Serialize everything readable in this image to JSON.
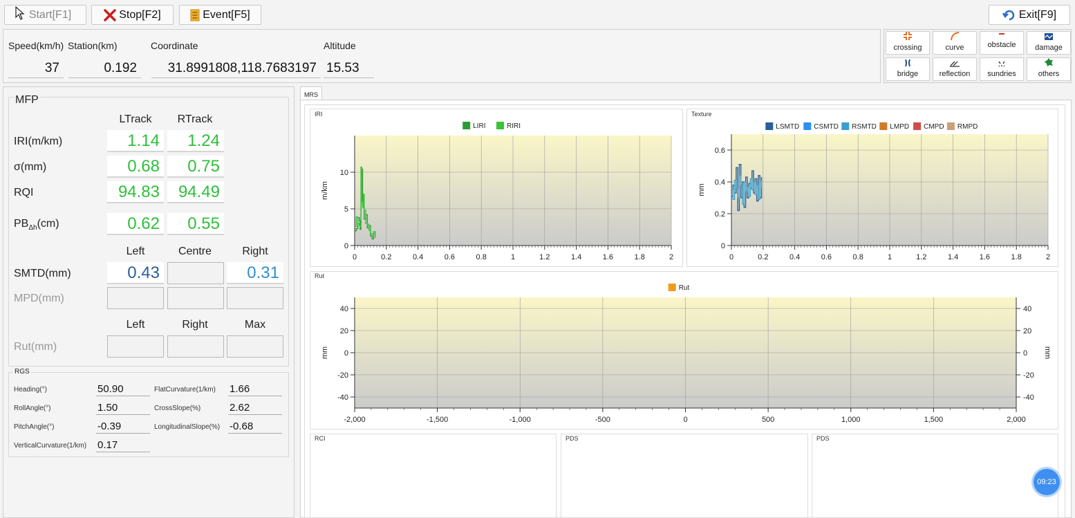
{
  "toolbar": {
    "start_label": "Start[F1]",
    "stop_label": "Stop[F2]",
    "event_label": "Event[F5]",
    "exit_label": "Exit[F9]"
  },
  "info": {
    "speed_label": "Speed(km/h)",
    "station_label": "Station(km)",
    "coordinate_label": "Coordinate",
    "altitude_label": "Altitude",
    "speed": "37",
    "station": "0.192",
    "coordinate": "31.8991808,118.7683197",
    "altitude": "15.53"
  },
  "events": [
    {
      "label": "crossing",
      "icon": "crossing-icon"
    },
    {
      "label": "curve",
      "icon": "curve-icon"
    },
    {
      "label": "obstacle",
      "icon": "obstacle-icon"
    },
    {
      "label": "damage",
      "icon": "damage-icon"
    },
    {
      "label": "bridge",
      "icon": "bridge-icon"
    },
    {
      "label": "reflection",
      "icon": "reflection-icon"
    },
    {
      "label": "sundries",
      "icon": "sundries-icon"
    },
    {
      "label": "others",
      "icon": "others-icon"
    }
  ],
  "mfp": {
    "title": "MFP",
    "ltrack_header": "LTrack",
    "rtrack_header": "RTrack",
    "iri_label": "IRI(m/km)",
    "sigma_label": "σ(mm)",
    "rqi_label": "RQI",
    "pb_label": "PB",
    "pb_sub": "Δh",
    "pb_unit": "(cm)",
    "iri_l": "1.14",
    "iri_r": "1.24",
    "sigma_l": "0.68",
    "sigma_r": "0.75",
    "rqi_l": "94.83",
    "rqi_r": "94.49",
    "pb_l": "0.62",
    "pb_r": "0.55",
    "left_header": "Left",
    "centre_header": "Centre",
    "right_header": "Right",
    "smtd_label": "SMTD(mm)",
    "mpd_label": "MPD(mm)",
    "smtd_left": "0.43",
    "smtd_centre": "",
    "smtd_right": "0.31",
    "rut_left_header": "Left",
    "rut_right_header": "Right",
    "rut_max_header": "Max",
    "rut_label": "Rut(mm)"
  },
  "rgs": {
    "title": "RGS",
    "heading_label": "Heading(°)",
    "heading": "50.90",
    "roll_label": "RollAngle(°)",
    "roll": "1.50",
    "pitch_label": "PitchAngle(°)",
    "pitch": "-0.39",
    "vcurv_label": "VerticalCurvature(1/km)",
    "vcurv": "0.17",
    "flatcurv_label": "FlatCurvature(1/km)",
    "flatcurv": "1.66",
    "cross_label": "CrossSlope(%)",
    "cross": "2.62",
    "long_label": "LongitudinalSlope(%)",
    "long": "-0.68"
  },
  "tab_label": "MRS",
  "clock": "09:23",
  "colors": {
    "liri": "#2e9a35",
    "riri": "#39c43a",
    "lsmtd": "#2a5f9a",
    "csmtd": "#2d8ff0",
    "rsmtd": "#3aa0d0",
    "lmpd": "#d07a2a",
    "cmpd": "#d24b4b",
    "rmpd": "#c8a07a",
    "rut": "#f39a1c",
    "plot_top": "#faf6c8",
    "plot_bottom": "#cfcfcf"
  },
  "chart_data": [
    {
      "panel_title": "IRI",
      "type": "line",
      "ylabel": "m/km",
      "xlim": [
        0,
        2
      ],
      "ylim": [
        0,
        15
      ],
      "x_ticks": [
        "0",
        "0.2",
        "0.4",
        "0.6",
        "0.8",
        "1",
        "1.2",
        "1.4",
        "1.6",
        "1.8",
        "2"
      ],
      "y_ticks": [
        "0",
        "5",
        "10"
      ],
      "legend": [
        "LIRI",
        "RIRI"
      ],
      "series": [
        {
          "name": "LIRI",
          "color": "#2e9a35",
          "x": [
            0.0,
            0.01,
            0.02,
            0.03,
            0.035,
            0.04,
            0.045,
            0.05,
            0.055,
            0.06,
            0.07,
            0.08,
            0.09,
            0.1,
            0.11,
            0.12,
            0.13
          ],
          "y": [
            2.0,
            2.3,
            3.8,
            3.4,
            2.2,
            10.5,
            10.4,
            5.5,
            6.8,
            3.6,
            4.2,
            2.4,
            2.7,
            1.3,
            0.9,
            1.7,
            1.1
          ]
        },
        {
          "name": "RIRI",
          "color": "#39c43a",
          "x": [
            0.0,
            0.01,
            0.02,
            0.03,
            0.035,
            0.04,
            0.045,
            0.05,
            0.055,
            0.06,
            0.07,
            0.08,
            0.09,
            0.1,
            0.11,
            0.12,
            0.13
          ],
          "y": [
            2.6,
            3.9,
            3.0,
            2.7,
            2.5,
            10.7,
            6.0,
            5.2,
            7.0,
            4.8,
            3.0,
            2.9,
            2.1,
            1.6,
            1.5,
            1.9,
            1.2
          ]
        }
      ]
    },
    {
      "panel_title": "Texture",
      "type": "line",
      "ylabel": "mm",
      "xlim": [
        0,
        2
      ],
      "ylim": [
        0,
        0.7
      ],
      "x_ticks": [
        "0",
        "0.2",
        "0.4",
        "0.6",
        "0.8",
        "1",
        "1.2",
        "1.4",
        "1.6",
        "1.8",
        "2"
      ],
      "y_ticks": [
        "0",
        "0.2",
        "0.4",
        "0.6"
      ],
      "legend": [
        "LSMTD",
        "CSMTD",
        "RSMTD",
        "LMPD",
        "CMPD",
        "RMPD"
      ],
      "series": [
        {
          "name": "LSMTD",
          "color": "#2a5f9a",
          "x": [
            0.0,
            0.01,
            0.02,
            0.03,
            0.04,
            0.05,
            0.06,
            0.07,
            0.08,
            0.09,
            0.1,
            0.11,
            0.12,
            0.13,
            0.14,
            0.15,
            0.16,
            0.17,
            0.18,
            0.19
          ],
          "y": [
            0.31,
            0.38,
            0.33,
            0.49,
            0.22,
            0.51,
            0.3,
            0.4,
            0.24,
            0.43,
            0.3,
            0.39,
            0.36,
            0.47,
            0.33,
            0.42,
            0.28,
            0.44,
            0.3,
            0.43
          ]
        },
        {
          "name": "RSMTD",
          "color": "#3aa0d0",
          "x": [
            0.0,
            0.01,
            0.02,
            0.03,
            0.04,
            0.05,
            0.06,
            0.07,
            0.08,
            0.09,
            0.1,
            0.11,
            0.12,
            0.13,
            0.14,
            0.15,
            0.16,
            0.17,
            0.18,
            0.19
          ],
          "y": [
            0.35,
            0.29,
            0.41,
            0.36,
            0.3,
            0.44,
            0.38,
            0.26,
            0.4,
            0.34,
            0.37,
            0.31,
            0.42,
            0.35,
            0.4,
            0.32,
            0.38,
            0.29,
            0.41,
            0.36
          ]
        }
      ]
    },
    {
      "panel_title": "Rut",
      "type": "line",
      "ylabel": "mm",
      "y2label": "mm",
      "xlim": [
        -2000,
        2000
      ],
      "ylim": [
        -50,
        50
      ],
      "x_ticks": [
        "-2,000",
        "-1,500",
        "-1,000",
        "-500",
        "0",
        "500",
        "1,000",
        "1,500",
        "2,000"
      ],
      "y_ticks": [
        "-40",
        "-20",
        "0",
        "20",
        "40"
      ],
      "legend": [
        "Rut"
      ],
      "series": [
        {
          "name": "Rut",
          "color": "#f39a1c",
          "x": [],
          "y": []
        }
      ]
    }
  ],
  "bottom_panels": [
    "RCI",
    "PDS",
    "PDS"
  ]
}
